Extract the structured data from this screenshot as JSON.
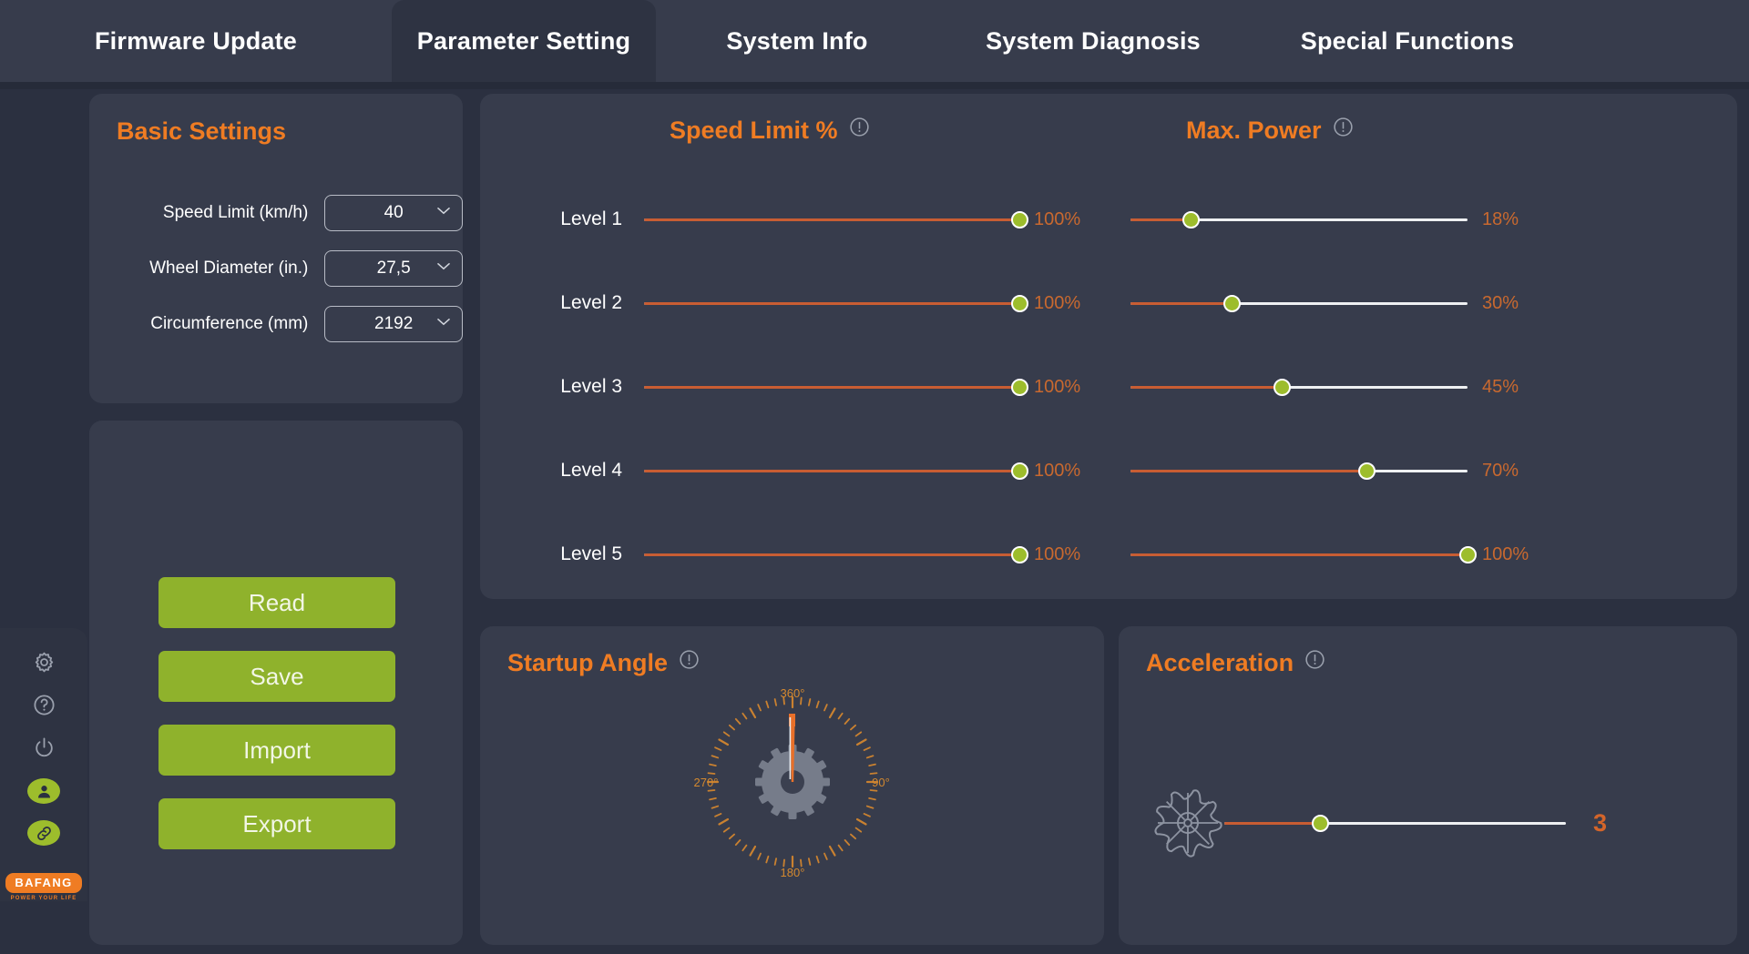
{
  "tabs": [
    {
      "label": "Firmware Update",
      "active": false
    },
    {
      "label": "Parameter Setting",
      "active": true
    },
    {
      "label": "System Info",
      "active": false
    },
    {
      "label": "System Diagnosis",
      "active": false
    },
    {
      "label": "Special Functions",
      "active": false
    }
  ],
  "sidebar": {
    "icons": [
      {
        "name": "settings-gear-icon",
        "label": "Settings"
      },
      {
        "name": "help-question-icon",
        "label": "Help"
      },
      {
        "name": "power-icon",
        "label": "Power"
      },
      {
        "name": "user-account-icon",
        "label": "Account"
      },
      {
        "name": "link-connect-icon",
        "label": "Connection"
      }
    ],
    "logo": {
      "brand": "BAFANG",
      "tagline": "POWER YOUR LIFE"
    }
  },
  "basic_settings": {
    "title": "Basic Settings",
    "fields": [
      {
        "label": "Speed Limit (km/h)",
        "value": "40"
      },
      {
        "label": "Wheel Diameter (in.)",
        "value": "27,5"
      },
      {
        "label": "Circumference (mm)",
        "value": "2192"
      }
    ]
  },
  "actions": {
    "buttons": [
      {
        "label": "Read"
      },
      {
        "label": "Save"
      },
      {
        "label": "Import"
      },
      {
        "label": "Export"
      }
    ]
  },
  "sliders_panel": {
    "speed_limit_title": "Speed Limit %",
    "max_power_title": "Max. Power",
    "info_glyph": "!",
    "rows": [
      {
        "level": "Level 1",
        "speed_value": "100%",
        "speed_pct": 100,
        "power_value": "18%",
        "power_pct": 18
      },
      {
        "level": "Level 2",
        "speed_value": "100%",
        "speed_pct": 100,
        "power_value": "30%",
        "power_pct": 30
      },
      {
        "level": "Level 3",
        "speed_value": "100%",
        "speed_pct": 100,
        "power_value": "45%",
        "power_pct": 45
      },
      {
        "level": "Level 4",
        "speed_value": "100%",
        "speed_pct": 100,
        "power_value": "70%",
        "power_pct": 70
      },
      {
        "level": "Level 5",
        "speed_value": "100%",
        "speed_pct": 100,
        "power_value": "100%",
        "power_pct": 100
      }
    ]
  },
  "startup_angle": {
    "title": "Startup Angle",
    "needle_degrees": 360,
    "tick_labels": {
      "top": "360°",
      "right": "90°",
      "bottom": "180°",
      "left": "270°"
    }
  },
  "acceleration": {
    "title": "Acceleration",
    "value": "3",
    "fill_pct": 28
  },
  "colors": {
    "accent_orange": "#ef7c23",
    "value_orange": "#c9692f",
    "track_fill": "#c85d33",
    "knob_green": "#9dbd2c",
    "button_green": "#8fb22c",
    "panel_bg": "#373c4c",
    "app_bg": "#2b3040",
    "tabbar_bg": "#373c4c",
    "active_tab_bg": "#2e3342"
  }
}
